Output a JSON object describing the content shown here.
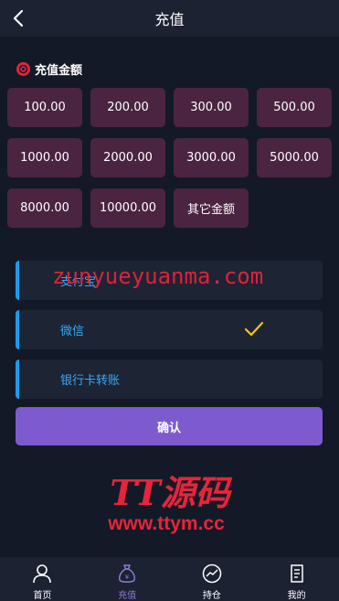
{
  "header": {
    "title": "充值"
  },
  "amount_section": {
    "title": "充值金额",
    "options": [
      "100.00",
      "200.00",
      "300.00",
      "500.00",
      "1000.00",
      "2000.00",
      "3000.00",
      "5000.00",
      "8000.00",
      "10000.00",
      "其它金额"
    ]
  },
  "payment_methods": [
    {
      "label": "支付宝",
      "selected": false
    },
    {
      "label": "微信",
      "selected": true
    },
    {
      "label": "银行卡转账",
      "selected": false
    }
  ],
  "confirm_label": "确认",
  "watermarks": {
    "url_text": "zunyueyuanma.com",
    "logo_title": "TT源码",
    "logo_url": "www.ttym.cc"
  },
  "tabs": [
    {
      "label": "首页",
      "icon": "person-icon",
      "active": false
    },
    {
      "label": "充值",
      "icon": "money-bag-icon",
      "active": true
    },
    {
      "label": "持仓",
      "icon": "chart-icon",
      "active": false
    },
    {
      "label": "我的",
      "icon": "document-icon",
      "active": false
    }
  ],
  "colors": {
    "background": "#141927",
    "amount_button": "#4a2440",
    "accent_blue": "#1e9bea",
    "confirm_purple": "#7d5bcf",
    "check_yellow": "#f5c518",
    "watermark_red": "#e8243a"
  }
}
